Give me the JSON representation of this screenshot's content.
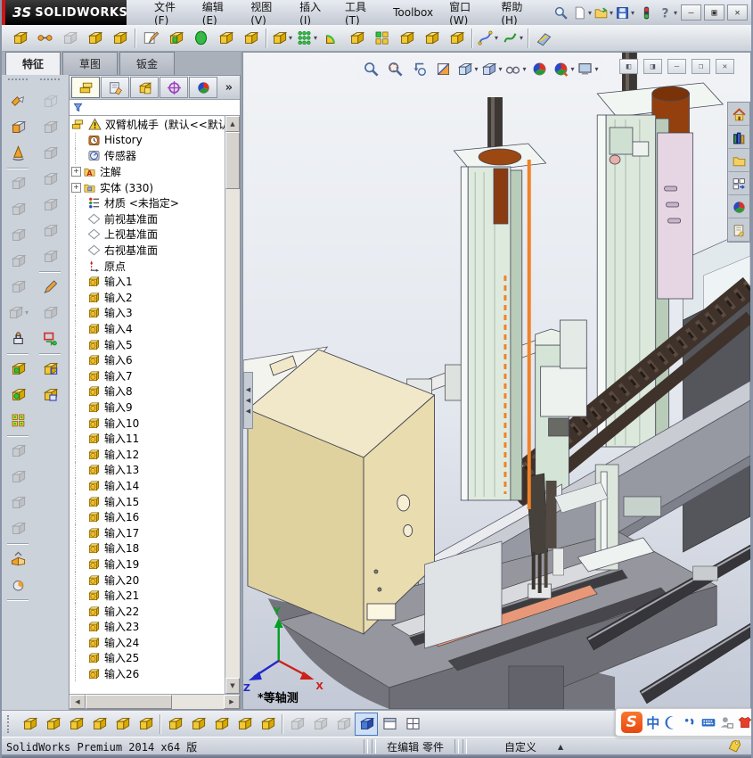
{
  "titlebar": {
    "logo_mark": "3S",
    "logo_text": "SOLIDWORKS",
    "menus": [
      "文件(F)",
      "编辑(E)",
      "视图(V)",
      "插入(I)",
      "工具(T)",
      "Toolbox",
      "窗口(W)",
      "帮助(H)"
    ],
    "quick_access": [
      {
        "i": "search-icon"
      },
      {
        "i": "new-document-icon",
        "drop": true
      },
      {
        "i": "open-icon",
        "drop": true
      },
      {
        "i": "save-icon",
        "drop": true
      },
      {
        "i": "options-traffic-light-icon"
      },
      {
        "i": "help-icon",
        "drop": true
      }
    ],
    "window_buttons": [
      {
        "i": "window-minimize-icon",
        "glyph": "–"
      },
      {
        "i": "window-maximize-icon",
        "glyph": "▣"
      },
      {
        "i": "window-close-icon",
        "glyph": "✕"
      }
    ]
  },
  "main_toolbar": {
    "buttons": [
      {
        "i": "edit-component-icon"
      },
      {
        "i": "smart-dimension-icon"
      },
      {
        "i": "undo-icon",
        "en": false
      },
      {
        "i": "boss-icon"
      },
      {
        "i": "folder-feature-icon"
      },
      {
        "sep": true
      },
      {
        "i": "sketch-icon"
      },
      {
        "i": "extrude-icon"
      },
      {
        "i": "revolve-icon"
      },
      {
        "i": "loft-icon"
      },
      {
        "i": "boundary-icon"
      },
      {
        "sep": true
      },
      {
        "i": "extruded-cut-icon",
        "drop": true
      },
      {
        "i": "hole-wizard-icon",
        "drop": true
      },
      {
        "i": "fillet-icon"
      },
      {
        "i": "chamfer-icon"
      },
      {
        "i": "linear-pattern-icon"
      },
      {
        "i": "draft-icon"
      },
      {
        "i": "shell-icon"
      },
      {
        "i": "rib-icon"
      },
      {
        "sep": true
      },
      {
        "i": "curve-icon",
        "drop": true
      },
      {
        "i": "spline-icon",
        "drop": true
      },
      {
        "sep": true
      },
      {
        "i": "reference-geometry-icon"
      }
    ]
  },
  "commandmanager": {
    "tabs": [
      {
        "label": "特征",
        "active": true
      },
      {
        "label": "草图",
        "active": false
      },
      {
        "label": "钣金",
        "active": false
      }
    ]
  },
  "left_toolbar_col1": [
    {
      "i": "insert-components-icon"
    },
    {
      "i": "move-component-icon"
    },
    {
      "i": "rotate-component-icon"
    },
    {
      "sep": true
    },
    {
      "i": "mate-icon",
      "en": false
    },
    {
      "i": "edit-part-icon",
      "en": false
    },
    {
      "i": "smart-fasteners-icon",
      "en": false
    },
    {
      "i": "move-with-triad-icon",
      "en": false
    },
    {
      "i": "assembly-features-icon",
      "en": false
    },
    {
      "i": "component-pattern-icon",
      "en": false,
      "drop": true
    },
    {
      "i": "interference-detection-icon"
    },
    {
      "sep": true
    },
    {
      "i": "new-part-icon"
    },
    {
      "i": "new-assembly-icon"
    },
    {
      "i": "pattern-grid-icon"
    },
    {
      "sep": true
    },
    {
      "i": "make-subassembly-icon",
      "en": false
    },
    {
      "i": "dissolve-subassembly-icon",
      "en": false
    },
    {
      "i": "large-assembly-icon",
      "en": false
    },
    {
      "i": "isolate-icon",
      "en": false
    },
    {
      "sep": true
    },
    {
      "i": "exploded-view-icon"
    },
    {
      "i": "instant3d-icon"
    },
    {
      "sep": true
    }
  ],
  "left_toolbar_col2": [
    {
      "i": "front-view-icon",
      "en": false
    },
    {
      "i": "back-view-icon",
      "en": false
    },
    {
      "i": "left-view-icon",
      "en": false
    },
    {
      "i": "right-view-icon",
      "en": false
    },
    {
      "i": "top-view-icon",
      "en": false
    },
    {
      "i": "bottom-view-icon",
      "en": false
    },
    {
      "i": "isometric-view-icon",
      "en": false
    },
    {
      "sep": true
    },
    {
      "i": "sketch-pencil-icon"
    },
    {
      "i": "3d-sketch-icon",
      "en": false
    },
    {
      "i": "rapid-sketch-icon"
    },
    {
      "sep": true
    },
    {
      "i": "exploded-cube-icon"
    },
    {
      "i": "section-cube-icon"
    }
  ],
  "feature_panel": {
    "header_tabs": [
      {
        "i": "featuremanager-tree-icon",
        "active": true
      },
      {
        "i": "propertymanager-icon"
      },
      {
        "i": "configurationmanager-icon"
      },
      {
        "i": "dimxpert-icon"
      },
      {
        "i": "displaymanager-icon"
      }
    ],
    "expand_label": "»",
    "filter_value": ""
  },
  "feature_tree": {
    "root_label": "双臂机械手",
    "root_suffix": "(默认<<默认",
    "items": [
      {
        "label": "History",
        "icon": "history-icon"
      },
      {
        "label": "传感器",
        "icon": "sensors-icon"
      },
      {
        "label": "注解",
        "icon": "annotations-icon",
        "expandable": true
      },
      {
        "label": "实体 (330)",
        "icon": "solid-bodies-icon",
        "expandable": true
      },
      {
        "label": "材质 <未指定>",
        "icon": "material-icon"
      },
      {
        "label": "前视基准面",
        "icon": "plane-icon"
      },
      {
        "label": "上视基准面",
        "icon": "plane-icon"
      },
      {
        "label": "右视基准面",
        "icon": "plane-icon"
      },
      {
        "label": "原点",
        "icon": "origin-icon"
      }
    ],
    "inputs": [
      "输入1",
      "输入2",
      "输入3",
      "输入4",
      "输入5",
      "输入6",
      "输入7",
      "输入8",
      "输入9",
      "输入10",
      "输入11",
      "输入12",
      "输入13",
      "输入14",
      "输入15",
      "输入16",
      "输入17",
      "输入18",
      "输入19",
      "输入20",
      "输入21",
      "输入22",
      "输入23",
      "输入24",
      "输入25",
      "输入26"
    ]
  },
  "viewport": {
    "view_name": "*等轴测",
    "triad": {
      "x": "X",
      "y": "Y",
      "z": "Z"
    },
    "hud_buttons": [
      {
        "i": "zoom-fit-icon"
      },
      {
        "i": "zoom-area-icon"
      },
      {
        "i": "previous-view-icon"
      },
      {
        "i": "section-view-icon"
      },
      {
        "i": "view-orientation-icon",
        "drop": true
      },
      {
        "i": "display-style-icon",
        "drop": true
      },
      {
        "i": "hide-show-items-icon",
        "drop": true
      },
      {
        "i": "realview-icon"
      },
      {
        "i": "appearances-icon",
        "drop": true
      },
      {
        "i": "scene-icon",
        "drop": true
      }
    ],
    "docwin_buttons": [
      {
        "i": "pane-left-icon",
        "glyph": "◧"
      },
      {
        "i": "pane-right-icon",
        "glyph": "◨"
      },
      {
        "i": "doc-minimize-icon",
        "glyph": "–"
      },
      {
        "i": "doc-restore-icon",
        "glyph": "❐"
      },
      {
        "i": "doc-close-icon",
        "glyph": "✕"
      }
    ],
    "taskpane_buttons": [
      {
        "i": "home-icon"
      },
      {
        "i": "design-library-icon"
      },
      {
        "i": "file-explorer-icon"
      },
      {
        "i": "view-palette-icon"
      },
      {
        "i": "appearances-sphere-icon"
      },
      {
        "i": "custom-properties-icon"
      }
    ]
  },
  "sketchbar": {
    "buttons": [
      {
        "i": "point-icon"
      },
      {
        "i": "circle-icon"
      },
      {
        "i": "line-icon"
      },
      {
        "i": "polygon-icon"
      },
      {
        "i": "trim-icon"
      },
      {
        "i": "perpendicular-icon"
      },
      {
        "sep": true
      },
      {
        "i": "arc-icon"
      },
      {
        "i": "mirror-icon"
      },
      {
        "i": "parallel-icon"
      },
      {
        "i": "corner-rectangle-icon"
      },
      {
        "i": "centerpoint-icon"
      },
      {
        "sep": true
      },
      {
        "i": "slot-icon",
        "en": false
      },
      {
        "i": "grid-icon",
        "en": false
      },
      {
        "i": "angle-snap-icon",
        "en": false
      },
      {
        "i": "shaded-view-icon",
        "active": true
      },
      {
        "i": "split-window-icon"
      },
      {
        "i": "design-table-icon"
      }
    ]
  },
  "statusbar": {
    "version": "SolidWorks Premium 2014 x64 版",
    "edit_mode": "在编辑 零件",
    "custom": "自定义"
  },
  "ime": {
    "mode_label": "中",
    "buttons": [
      {
        "i": "sogou-logo-icon"
      },
      {
        "i": "chinese-mode-icon",
        "text": true
      },
      {
        "i": "moon-icon"
      },
      {
        "i": "punctuation-icon"
      },
      {
        "i": "keyboard-icon"
      },
      {
        "i": "account-icon"
      },
      {
        "i": "skin-icon"
      }
    ]
  },
  "colors": {
    "accent_orange": "#f08228",
    "tower_green": "#dce8dc",
    "cabinet_cream": "#ece1b4",
    "beam_gray": "#9699a2",
    "chain_brown": "#3e322a",
    "triad_x": "#cc2018",
    "triad_y": "#00a020",
    "triad_z": "#2028c8"
  }
}
